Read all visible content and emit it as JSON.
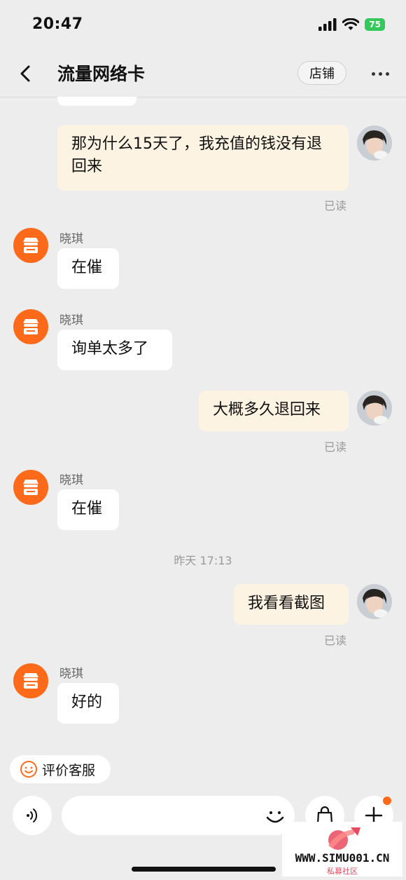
{
  "status_bar": {
    "time": "20:47",
    "battery": "75"
  },
  "header": {
    "title": "流量网络卡",
    "shop_label": "店铺"
  },
  "messages": [
    {
      "type": "me",
      "text": "那为什么15天了，我充值的钱没有退回来",
      "status": "已读"
    },
    {
      "type": "them",
      "sender": "晓琪",
      "text": "在催"
    },
    {
      "type": "them",
      "sender": "晓琪",
      "text": "询单太多了"
    },
    {
      "type": "me",
      "text": "大概多久退回来",
      "status": "已读"
    },
    {
      "type": "them",
      "sender": "晓琪",
      "text": "在催"
    },
    {
      "type": "time",
      "text": "昨天 17:13"
    },
    {
      "type": "me",
      "text": "我看看截图",
      "status": "已读"
    },
    {
      "type": "them",
      "sender": "晓琪",
      "text": "好的"
    }
  ],
  "bottom": {
    "rate_label": "评价客服"
  },
  "watermark": {
    "domain": "WWW.SIMU001.CN",
    "subtitle": "私募社区"
  },
  "colors": {
    "me_bubble": "#fdf3e3",
    "shop_avatar": "#ff6a1a",
    "battery": "#34c759",
    "badge": "#ff6a1a"
  }
}
